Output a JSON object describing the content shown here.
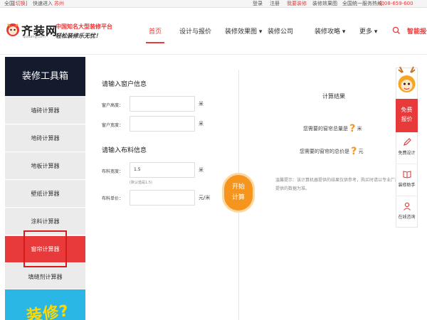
{
  "topbar": {
    "city_label": "全国",
    "switch_label": "[切换]",
    "quick_enter": "快速进入",
    "city": "苏州",
    "login": "登录",
    "register": "注册",
    "free_design": "我要装修",
    "effect": "装修效果图",
    "hotline": "全国统一服务热线：",
    "phone": "4008-659-600"
  },
  "header": {
    "logo_text": "齐装网",
    "logo_url": "qizuang.com",
    "slogan_line1": "中国知名大型装修平台",
    "slogan_line2": "轻松装修乐无忧！",
    "nav": [
      {
        "label": "首页"
      },
      {
        "label": "设计与报价"
      },
      {
        "label": "装修效果图 ▾"
      },
      {
        "label": "装修公司"
      },
      {
        "label": "装修攻略 ▾"
      },
      {
        "label": "更多 ▾"
      }
    ],
    "smart_quote": "智能报价"
  },
  "sidebar": {
    "title": "装修工具箱",
    "items": [
      {
        "label": "墙砖计算器"
      },
      {
        "label": "地砖计算器"
      },
      {
        "label": "地板计算器"
      },
      {
        "label": "壁纸计算器"
      },
      {
        "label": "涂料计算器"
      },
      {
        "label": "窗帘计算器"
      },
      {
        "label": "填缝剂计算器"
      }
    ],
    "banner_text": "装修?"
  },
  "window_section": {
    "title": "请输入窗户信息",
    "height_label": "窗户高度：",
    "height_value": "",
    "height_unit": "米",
    "width_label": "窗户宽度：",
    "width_value": "",
    "width_unit": "米"
  },
  "cloth_section": {
    "title": "请输入布料信息",
    "width_label": "布料宽度：",
    "width_value": "1.5",
    "width_unit": "米",
    "width_hint": "(默认值是1.5)",
    "price_label": "布料单价：",
    "price_value": "",
    "price_unit": "元/米"
  },
  "calc_button": {
    "line1": "开始",
    "line2": "计算"
  },
  "result": {
    "title": "计算结果",
    "total_length_prefix": "您需要的窗帘总量是",
    "total_length_value": "?",
    "total_length_unit": "米",
    "total_price_prefix": "您需要的窗帘的总价是",
    "total_price_value": "?",
    "total_price_unit": "元",
    "tip": "温馨提示：该计算机器提供的结果仅供参考，购买时请以专业厂商提供的数据为准。"
  },
  "float_panel": {
    "free_quote_line1": "免费",
    "free_quote_line2": "报价",
    "items": [
      {
        "label": "免费设计",
        "icon": "pencil-icon"
      },
      {
        "label": "装修助手",
        "icon": "book-icon"
      },
      {
        "label": "在线咨询",
        "icon": "person-icon"
      }
    ]
  },
  "colors": {
    "accent": "#e83a3a",
    "calc": "#f5951e",
    "sidebar_head": "#141b2d",
    "banner": "#2bb7e6"
  }
}
